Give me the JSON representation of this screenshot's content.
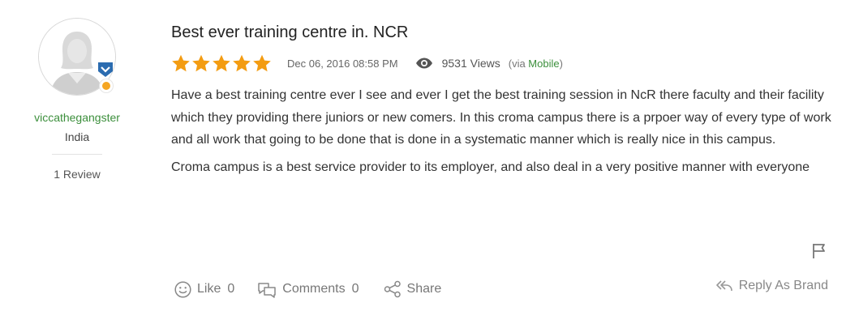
{
  "reviewer": {
    "username": "viccathegangster",
    "country": "India",
    "review_count": "1 Review",
    "badge_color": "#2b6cb0",
    "status_color": "#f5a623"
  },
  "review": {
    "title": "Best ever training centre in. NCR",
    "rating": 5,
    "rating_max": 5,
    "star_color": "#f39c12",
    "date": "Dec 06, 2016 08:58 PM",
    "views": "9531 Views",
    "via_prefix": "(via ",
    "via_source": "Mobile",
    "via_suffix": ")",
    "paragraphs": [
      "Have a best training centre ever I see and ever I get the best training session in NcR there faculty and their facility which they providing there juniors or new comers. In this croma campus there is a prpoer way of every type of work and all work that going to be done that is done in a systematic manner which is really nice in this campus.",
      "Croma campus is a best service provider to its employer, and also deal in a very positive manner with everyone"
    ]
  },
  "actions": {
    "like_label": "Like",
    "like_count": "0",
    "comments_label": "Comments",
    "comments_count": "0",
    "share_label": "Share",
    "reply_label": "Reply As Brand"
  },
  "icons": {
    "avatar": "user-avatar-placeholder",
    "badge": "verified-shield-icon",
    "views": "eye-icon",
    "flag": "flag-icon",
    "like": "smiley-icon",
    "comments": "comment-bubbles-icon",
    "share": "share-icon",
    "reply": "reply-all-icon"
  }
}
